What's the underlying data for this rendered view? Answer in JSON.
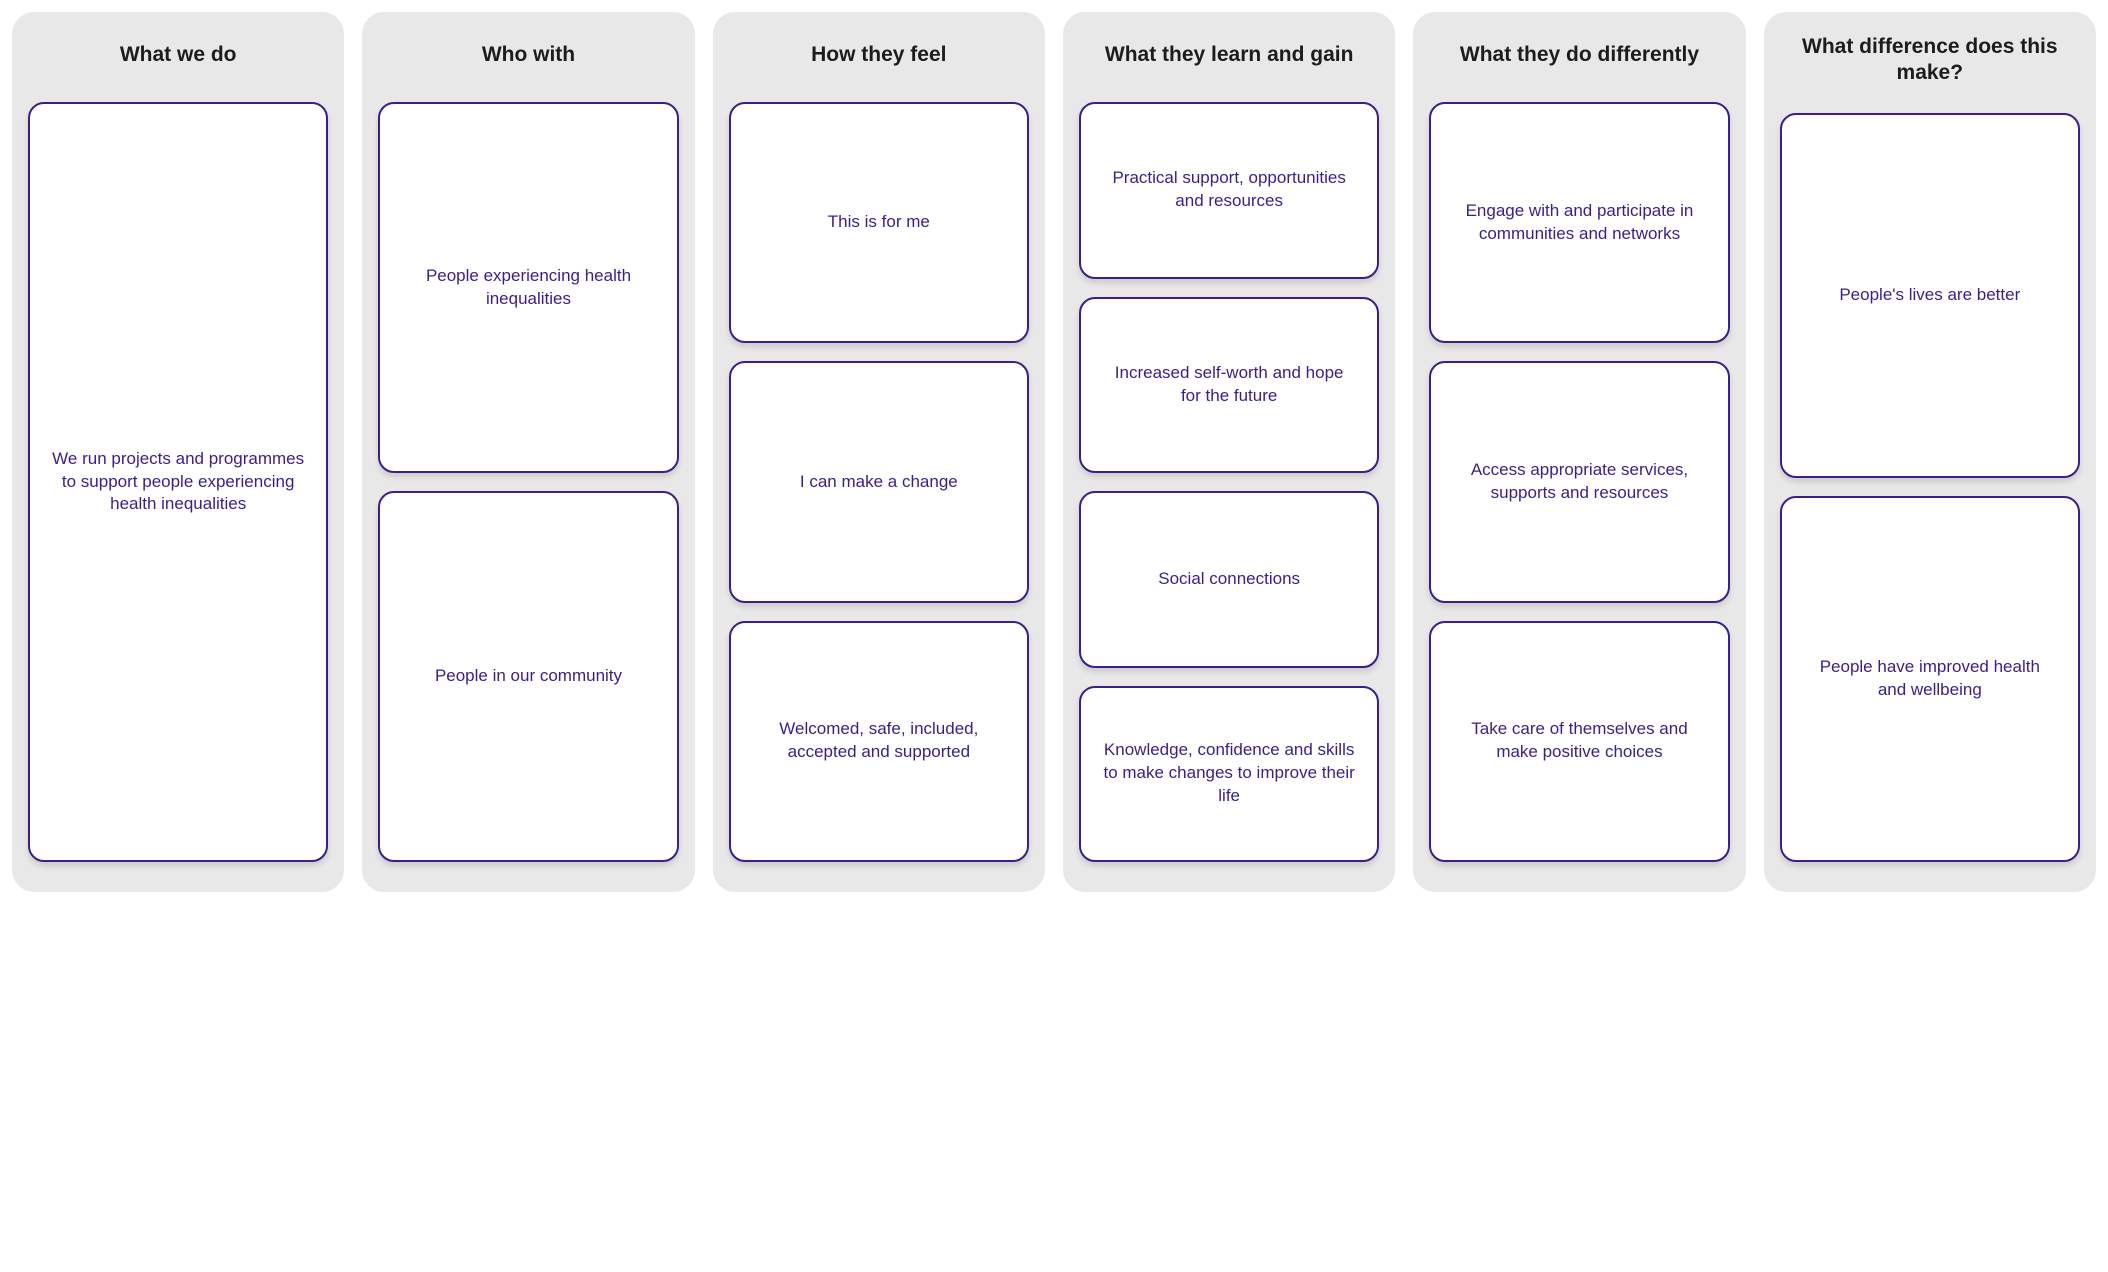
{
  "columns": [
    {
      "header": "What we do",
      "cards": [
        {
          "text": "We run projects and programmes to support people experiencing health inequalities"
        }
      ]
    },
    {
      "header": "Who with",
      "cards": [
        {
          "text": "People experiencing health inequalities"
        },
        {
          "text": "People in our community"
        }
      ]
    },
    {
      "header": "How they feel",
      "cards": [
        {
          "text": "This is for me"
        },
        {
          "text": "I can make a change"
        },
        {
          "text": "Welcomed, safe, included, accepted and supported"
        }
      ]
    },
    {
      "header": "What they learn and gain",
      "cards": [
        {
          "text": "Practical support, opportunities and resources"
        },
        {
          "text": "Increased self-worth and hope for the future"
        },
        {
          "text": "Social connections"
        },
        {
          "text": "Knowledge, confidence and skills to make changes to improve their life"
        }
      ]
    },
    {
      "header": "What they do differently",
      "cards": [
        {
          "text": "Engage with and participate in communities and networks"
        },
        {
          "text": "Access appropriate services, supports and resources"
        },
        {
          "text": "Take care of themselves and make positive choices"
        }
      ]
    },
    {
      "header": "What difference does this make?",
      "cards": [
        {
          "text": "People's lives are better"
        },
        {
          "text": "People have improved health and wellbeing"
        }
      ]
    }
  ]
}
